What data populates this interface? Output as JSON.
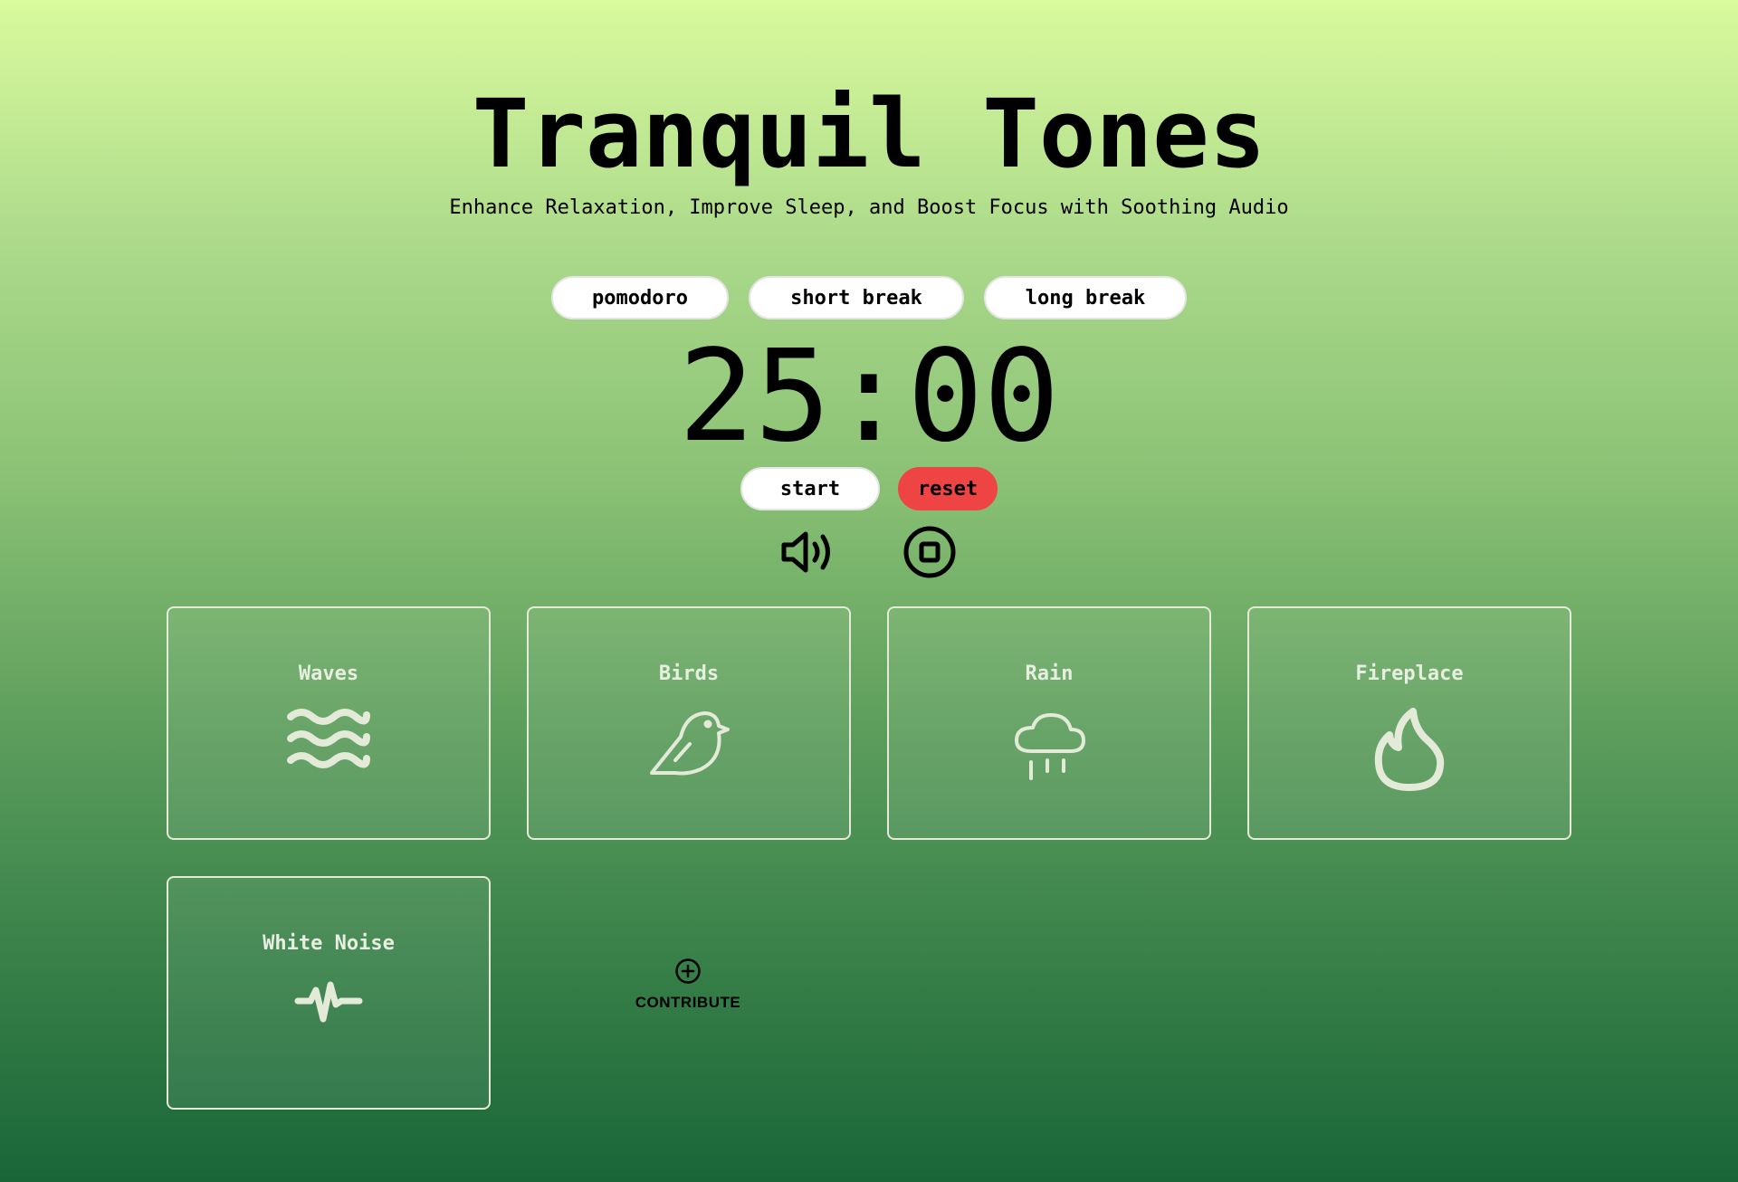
{
  "header": {
    "title": "Tranquil Tones",
    "subtitle": "Enhance Relaxation, Improve Sleep, and Boost Focus with Soothing Audio"
  },
  "timer": {
    "modes": [
      "pomodoro",
      "short break",
      "long break"
    ],
    "display": "25:00",
    "start_label": "start",
    "reset_label": "reset"
  },
  "audio_controls": {
    "volume_icon": "speaker-volume-icon",
    "stop_icon": "stop-circle-icon"
  },
  "sounds": [
    {
      "label": "Waves",
      "icon": "waves-icon"
    },
    {
      "label": "Birds",
      "icon": "bird-icon"
    },
    {
      "label": "Rain",
      "icon": "cloud-rain-icon"
    },
    {
      "label": "Fireplace",
      "icon": "flame-icon"
    },
    {
      "label": "White Noise",
      "icon": "pulse-icon"
    }
  ],
  "contribute": {
    "label": "CONTRIBUTE",
    "icon": "plus-circle-icon"
  },
  "colors": {
    "reset": "#ef4444",
    "card_border": "#e3ead8",
    "gradient_top": "#d9fa9d",
    "gradient_bottom": "#1a6638"
  }
}
